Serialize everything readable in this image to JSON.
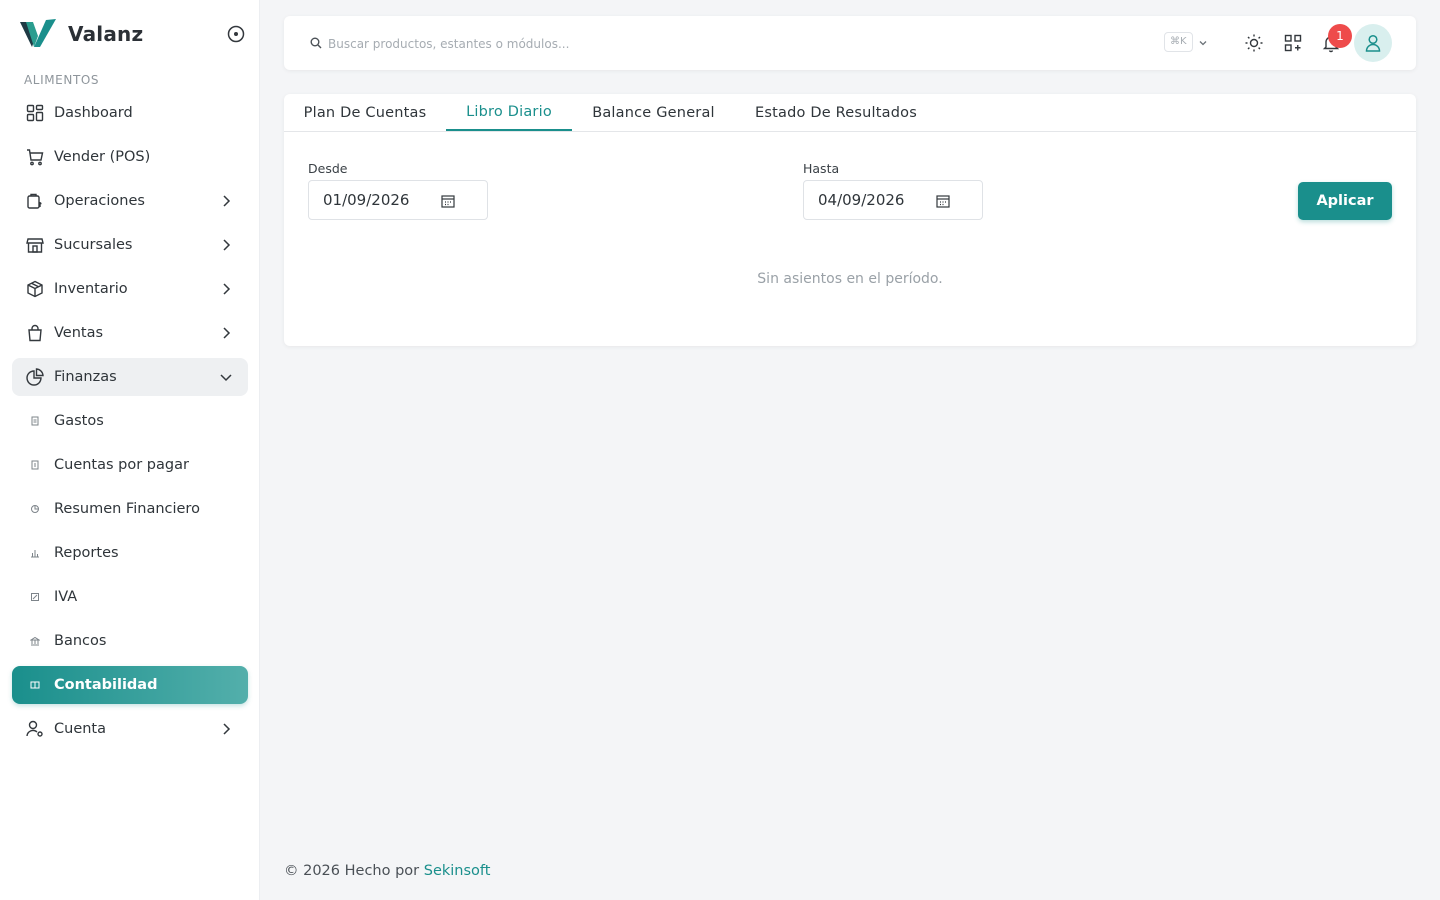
{
  "brand": {
    "name": "Valanz"
  },
  "sidebar": {
    "section": "ALIMENTOS",
    "items": [
      {
        "label": "Dashboard"
      },
      {
        "label": "Vender (POS)"
      },
      {
        "label": "Operaciones"
      },
      {
        "label": "Sucursales"
      },
      {
        "label": "Inventario"
      },
      {
        "label": "Ventas"
      },
      {
        "label": "Finanzas"
      },
      {
        "label": "Gastos"
      },
      {
        "label": "Cuentas por pagar"
      },
      {
        "label": "Resumen Financiero"
      },
      {
        "label": "Reportes"
      },
      {
        "label": "IVA"
      },
      {
        "label": "Bancos"
      },
      {
        "label": "Contabilidad"
      },
      {
        "label": "Cuenta"
      }
    ]
  },
  "topbar": {
    "search_placeholder": "Buscar productos, estantes o módulos...",
    "shortcut": "⌘K",
    "notifications_count": "1"
  },
  "tabs": [
    {
      "label": "Plan De Cuentas"
    },
    {
      "label": "Libro Diario"
    },
    {
      "label": "Balance General"
    },
    {
      "label": "Estado De Resultados"
    }
  ],
  "filters": {
    "from_label": "Desde",
    "from_value": "01/09/2026",
    "to_label": "Hasta",
    "to_value": "04/09/2026",
    "apply_label": "Aplicar"
  },
  "empty_message": "Sin asientos en el período.",
  "footer": {
    "text": "© 2026 Hecho por",
    "link": "Sekinsoft"
  },
  "colors": {
    "accent": "#1a8f8c",
    "badge": "#ee4b4b",
    "background": "#f4f5f7"
  }
}
